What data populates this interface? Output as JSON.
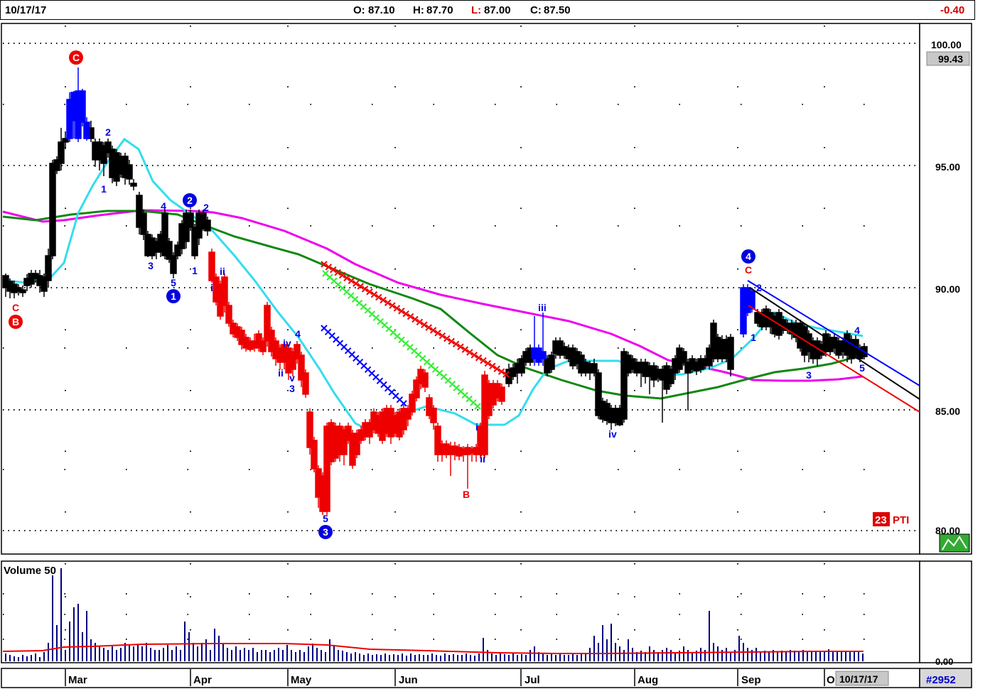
{
  "header": {
    "date": "10/17/17",
    "open_label": "O:",
    "open": "87.10",
    "high_label": "H:",
    "high": "87.70",
    "low_label": "L:",
    "low": "87.00",
    "close_label": "C:",
    "close": "87.50",
    "change": "-0.40"
  },
  "price_panel": {
    "y_ticks": [
      "100.00",
      "95.00",
      "90.00",
      "85.00",
      "80.00"
    ],
    "last_price_label": "99.43",
    "indicator_badge": "23",
    "indicator_label": "PTI"
  },
  "volume_panel": {
    "title": "Volume 50",
    "y_tick": "0.00"
  },
  "footer": {
    "months": [
      "Mar",
      "Apr",
      "May",
      "Jun",
      "Jul",
      "Aug",
      "Sep",
      "O"
    ],
    "current_date": "10/17/17",
    "chart_id": "#2952"
  },
  "wave_labels": {
    "circled": [
      "C",
      "B",
      "1",
      "2",
      "3",
      "4"
    ],
    "minor": [
      "1",
      "2",
      "3",
      "4",
      "5",
      "1",
      "2",
      "i",
      "ii",
      "iv",
      "4",
      "ii",
      "v",
      "3",
      "5",
      "i",
      "ii",
      "B",
      "iii",
      "iv",
      "C",
      "2",
      "1",
      "3",
      "4",
      "5",
      "C"
    ]
  },
  "colors": {
    "up_bar": "#ffffff",
    "down_bar": "#000000",
    "red_wave": "#ee0000",
    "blue_wave": "#0000ff",
    "ma_fast": "#33ddee",
    "ma_mid": "#118811",
    "ma_slow": "#ee00ee",
    "volume": "#000080",
    "volume_ma": "#ee0000"
  },
  "chart_data": {
    "type": "candlestick",
    "x": [
      "Mar",
      "Apr",
      "May",
      "Jun",
      "Jul",
      "Aug",
      "Sep",
      "Oct"
    ],
    "ylim": [
      79.2,
      100.7
    ],
    "last_bar": {
      "open": 87.1,
      "high": 87.7,
      "low": 87.0,
      "close": 87.5
    },
    "approx_closes": [
      90.1,
      95.5,
      97.5,
      95.0,
      93.0,
      92.0,
      90.8,
      88.3,
      87.6,
      86.3,
      82.0,
      84.0,
      84.4,
      86.5,
      83.5,
      83.1,
      86.2,
      87.5,
      87.1,
      85.0,
      87.0,
      87.0,
      87.7,
      89.5,
      88.5,
      87.8,
      87.5
    ]
  }
}
